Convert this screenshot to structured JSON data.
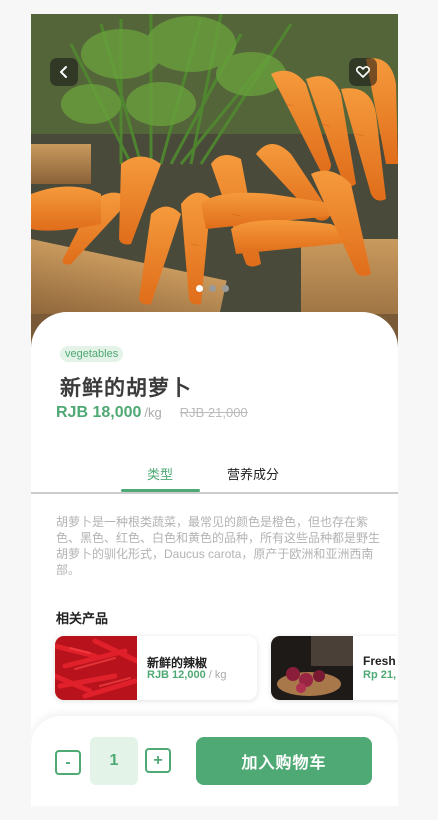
{
  "product": {
    "category": "vegetables",
    "name": "新鲜的胡萝卜",
    "price": "RJB 18,000",
    "unit": "/kg",
    "old_price": "RJB 21,000",
    "description": "胡萝卜是一种根类蔬菜，最常见的颜色是橙色，但也存在紫色、黑色、红色、白色和黄色的品种，所有这些品种都是野生胡萝卜的驯化形式，Daucus carota，原产于欧洲和亚洲西南部。",
    "gallery": {
      "count": 3,
      "active_index": 0
    }
  },
  "icons": {
    "back": "chevron-left-icon",
    "favorite": "heart-icon"
  },
  "tabs": [
    {
      "label": "类型",
      "active": true
    },
    {
      "label": "营养成分",
      "active": false
    }
  ],
  "related": {
    "title": "相关产品",
    "items": [
      {
        "name": "新鲜的辣椒",
        "price": "RJB 12,000",
        "unit": "/ kg"
      },
      {
        "name": "Fresh",
        "price": "Rp 21,",
        "unit": ""
      }
    ]
  },
  "cart": {
    "minus": "-",
    "quantity": "1",
    "plus": "+",
    "add_label": "加入购物车"
  },
  "colors": {
    "accent": "#4fa974",
    "accent_light": "#e3f3e7"
  }
}
